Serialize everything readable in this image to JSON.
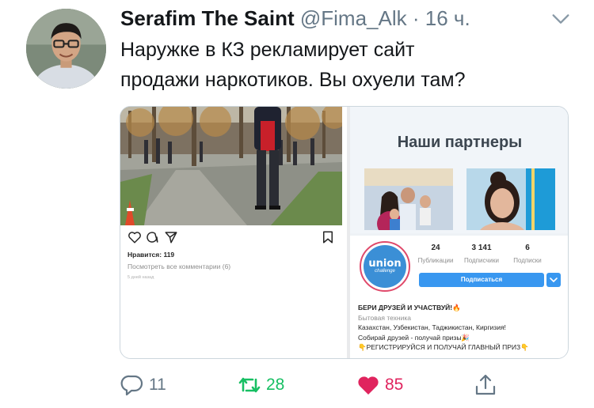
{
  "tweet": {
    "display_name": "Serafim The Saint",
    "handle": "@Fima_Alk",
    "separator": "·",
    "time": "16 ч.",
    "text_line1": "Наружке в КЗ рекламирует сайт",
    "text_line2": "продажи наркотиков. Вы охуели там?"
  },
  "post": {
    "likes": "Нравится: 119",
    "comments": "Посмотреть все комментарии (6)",
    "date": "5 дней назад"
  },
  "partners": {
    "title": "Наши партнеры"
  },
  "profile": {
    "logo_text": "union",
    "logo_subtext": "challenge",
    "stats": [
      {
        "value": "24",
        "label": "Публикации"
      },
      {
        "value": "3 141",
        "label": "Подписчики"
      },
      {
        "value": "6",
        "label": "Подписки"
      }
    ],
    "follow_label": "Подписаться",
    "bio": {
      "headline": "БЕРИ ДРУЗЕЙ И УЧАСТВУЙ!🔥",
      "category": "Бытовая техника",
      "line1": "Казахстан, Узбекистан, Таджикистан, Киргизия!",
      "line2": "Собирай друзей - получай призы🎉",
      "line3": "👇РЕГИСТРИРУЙСЯ И ПОЛУЧАЙ ГЛАВНЫЙ ПРИЗ👇"
    }
  },
  "actions": {
    "replies": "11",
    "retweets": "28",
    "likes": "85"
  },
  "colors": {
    "retweet": "#17bf63",
    "like": "#e0245e",
    "muted": "#657786",
    "instagram_blue": "#3897f0"
  },
  "icons": [
    "chevron-down-icon",
    "heart-outline-icon",
    "comment-icon",
    "send-icon",
    "bookmark-icon",
    "reply-icon",
    "retweet-icon",
    "like-icon",
    "share-icon"
  ]
}
